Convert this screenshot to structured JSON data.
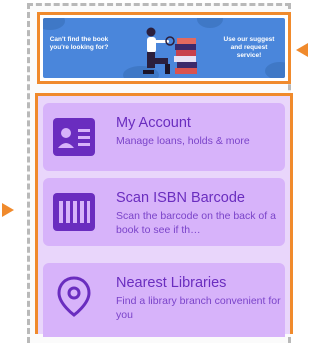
{
  "banner": {
    "left_text": "Can't find the book you're looking for?",
    "right_text": "Use our suggest and request service!",
    "colors": {
      "background": "#4a86db",
      "highlight": "#f08a2c"
    }
  },
  "menu": {
    "items": [
      {
        "icon": "account-card-icon",
        "title": "My Account",
        "description": "Manage loans, holds & more"
      },
      {
        "icon": "barcode-icon",
        "title": "Scan ISBN Barcode",
        "description": "Scan the barcode on the back of a book to see if th…"
      },
      {
        "icon": "location-pin-icon",
        "title": "Nearest Libraries",
        "description": "Find a library branch convenient for you"
      }
    ],
    "colors": {
      "background": "#e9d6fb",
      "card": "#d7b3fa",
      "accent": "#6a2dbf"
    }
  }
}
